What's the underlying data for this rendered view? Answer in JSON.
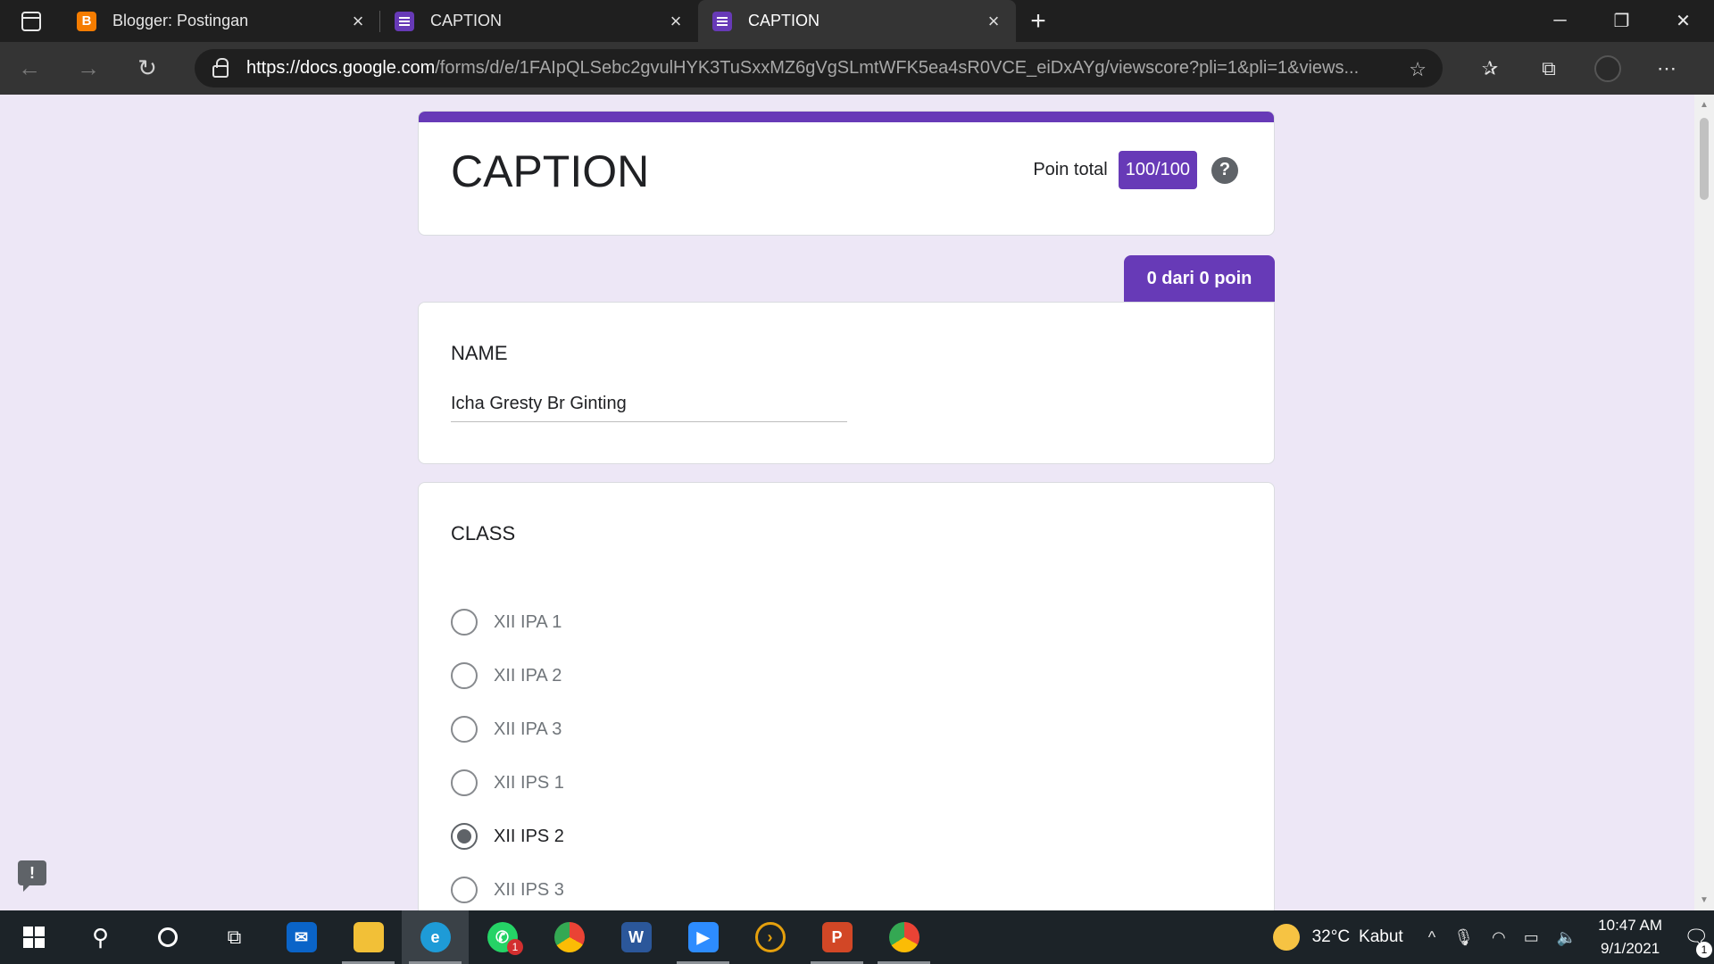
{
  "browser": {
    "tabs": [
      {
        "title": "Blogger: Postingan",
        "favicon": "blogger-icon",
        "active": false
      },
      {
        "title": "CAPTION",
        "favicon": "google-forms-icon",
        "active": false
      },
      {
        "title": "CAPTION",
        "favicon": "google-forms-icon",
        "active": true
      }
    ],
    "url_host": "https://docs.google.com",
    "url_path": "/forms/d/e/1FAIpQLSebc2gvulHYK3TuSxxMZ6gVgSLmtWFK5ea4sR0VCE_eiDxAYg/viewscore?pli=1&pli=1&views..."
  },
  "form": {
    "title": "CAPTION",
    "points_label": "Poin total",
    "points_value": "100/100",
    "help_symbol": "?",
    "question_points": "0 dari 0 poin",
    "accent_color": "#673ab7",
    "questions": [
      {
        "title": "NAME",
        "answer": "Icha Gresty Br Ginting"
      },
      {
        "title": "CLASS",
        "options": [
          {
            "label": "XII IPA 1",
            "selected": false
          },
          {
            "label": "XII IPA 2",
            "selected": false
          },
          {
            "label": "XII IPA 3",
            "selected": false
          },
          {
            "label": "XII IPS 1",
            "selected": false
          },
          {
            "label": "XII IPS 2",
            "selected": true
          },
          {
            "label": "XII IPS 3",
            "selected": false
          }
        ]
      }
    ]
  },
  "taskbar": {
    "apps": [
      "start-icon",
      "search-icon",
      "cortana-icon",
      "task-view-icon",
      "mail-icon",
      "file-explorer-icon",
      "edge-icon",
      "whatsapp-icon",
      "chrome-icon",
      "word-icon",
      "zoom-icon",
      "plex-icon",
      "powerpoint-icon",
      "chrome-profile-icon"
    ],
    "whatsapp_badge": "1",
    "temperature": "32°C",
    "weather": "Kabut",
    "time": "10:47 AM",
    "date": "9/1/2021",
    "notification_count": "1"
  }
}
